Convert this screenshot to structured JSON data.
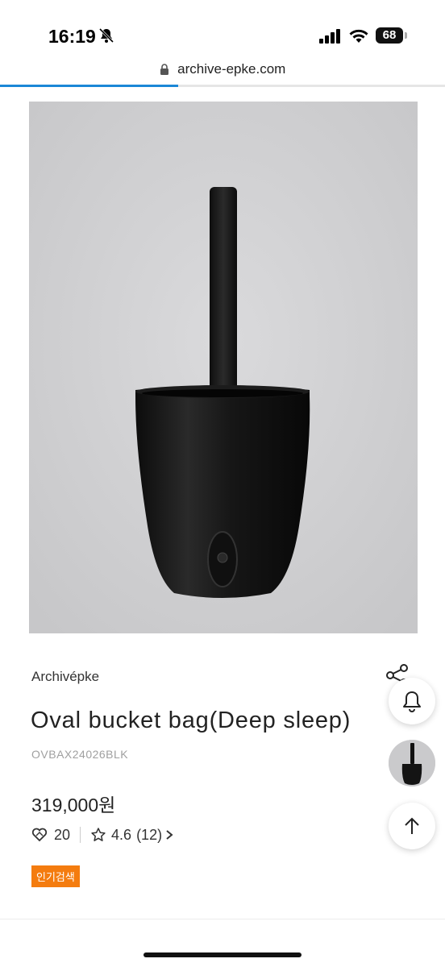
{
  "status_bar": {
    "time": "16:19",
    "battery": "68"
  },
  "browser": {
    "url": "archive-epke.com",
    "progress": 0.4
  },
  "product": {
    "brand": "Archivépke",
    "title": "Oval bucket bag(Deep sleep)",
    "code": "OVBAX24026BLK",
    "price": "319,000원",
    "likes": "20",
    "rating": "4.6",
    "review_count": "(12)",
    "tag": "인기검색"
  },
  "icons": {
    "bell": "bell-icon",
    "share": "share-icon",
    "scroll_top": "arrow-up-icon",
    "heart": "heart-icon",
    "star": "star-icon"
  },
  "colors": {
    "tag": "#f47c0f",
    "progress": "#1b87d6"
  }
}
